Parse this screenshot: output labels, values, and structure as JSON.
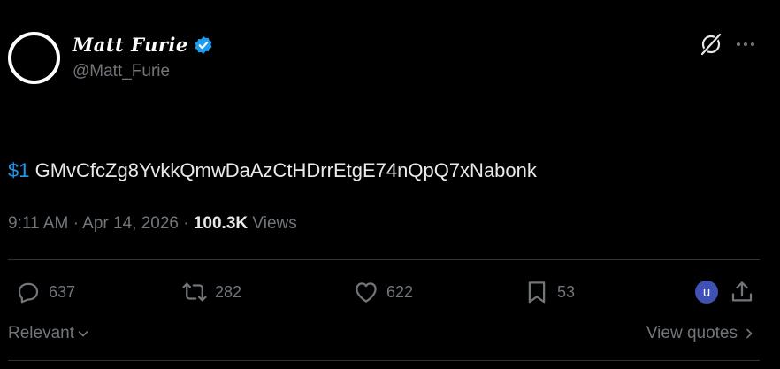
{
  "author": {
    "display_name": "Matt Furie",
    "handle": "@Matt_Furie",
    "verified": true
  },
  "tweet": {
    "cashtag": "$1",
    "text": " GMvCfcZg8YvkkQmwDaAzCtHDrrEtgE74nQpQ7xNabonk"
  },
  "meta": {
    "time": "9:11 AM",
    "separator": " · ",
    "date": "Apr 14, 2026",
    "views_count": "100.3K",
    "views_label": " Views"
  },
  "actions": {
    "replies": "637",
    "reposts": "282",
    "likes": "622",
    "bookmarks": "53",
    "user_badge": "u"
  },
  "footer": {
    "sort_label": "Relevant",
    "view_quotes_label": "View quotes"
  },
  "colors": {
    "background": "#000000",
    "accent": "#1d9bf0",
    "muted": "#71767b",
    "text": "#e7e9ea",
    "badge": "#3f51b5"
  },
  "icons": [
    "verified-badge-icon",
    "grok-icon",
    "more-icon",
    "reply-icon",
    "repost-icon",
    "like-icon",
    "bookmark-icon",
    "share-icon",
    "chevron-down-icon",
    "chevron-right-icon"
  ]
}
